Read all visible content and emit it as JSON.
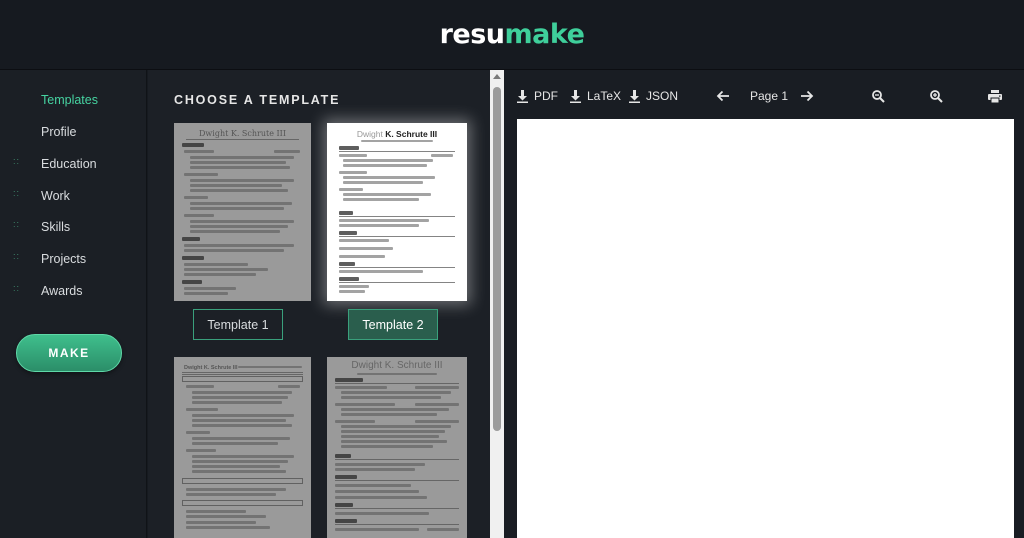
{
  "logo": {
    "part1": "resu",
    "part2": "make"
  },
  "sidebar": {
    "items": [
      {
        "label": "Templates",
        "active": true
      },
      {
        "label": "Profile"
      },
      {
        "label": "Education"
      },
      {
        "label": "Work"
      },
      {
        "label": "Skills"
      },
      {
        "label": "Projects"
      },
      {
        "label": "Awards"
      }
    ],
    "make_label": "MAKE"
  },
  "templates": {
    "heading": "CHOOSE A TEMPLATE",
    "cards": [
      {
        "preview_name": "Dwight K. Schrute III",
        "button_label": "Template 1"
      },
      {
        "preview_name_light": "Dwight ",
        "preview_name_bold": "K. Schrute III",
        "button_label": "Template 2",
        "selected": true
      },
      {
        "preview_name": "Dwight K. Schrute III"
      },
      {
        "preview_name": "Dwight K. Schrute III"
      }
    ]
  },
  "preview_toolbar": {
    "pdf": "PDF",
    "latex": "LaTeX",
    "json": "JSON",
    "page": "Page 1"
  },
  "colors": {
    "accent": "#3fcf9b",
    "bg": "#161a20",
    "panel": "#1c2026"
  }
}
